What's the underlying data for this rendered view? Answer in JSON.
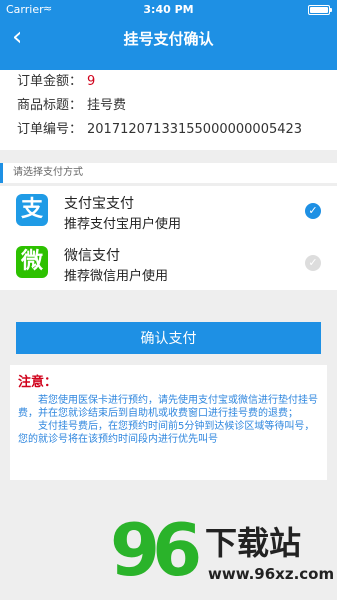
{
  "status": {
    "carrier": "Carrier",
    "wifi": "≈",
    "time": "3:40 PM"
  },
  "nav": {
    "back": "‹",
    "title": "挂号支付确认"
  },
  "order": {
    "amount_label": "订单金额：",
    "amount_value": "9",
    "product_label": "商品标题：",
    "product_value": "挂号费",
    "number_label": "订单编号：",
    "number_value": "20171207133155000000005423"
  },
  "section_title": "请选择支付方式",
  "payments": [
    {
      "icon": "支",
      "name": "支付宝支付",
      "desc": "推荐支付宝用户使用",
      "selected": true
    },
    {
      "icon": "微",
      "name": "微信支付",
      "desc": "推荐微信用户使用",
      "selected": false
    }
  ],
  "confirm_label": "确认支付",
  "notice": {
    "title": "注意：",
    "p1": "若您使用医保卡进行预约，请先使用支付宝或微信进行垫付挂号费，并在您就诊结束后到自助机或收费窗口进行挂号费的退费；",
    "p2": "支付挂号费后，在您预约时间前5分钟到达候诊区域等待叫号，您的就诊号将在该预约时间段内进行优先叫号"
  },
  "watermark": {
    "num": "96",
    "text": "下载站",
    "url": "www.96xz.com"
  },
  "colors": {
    "primary": "#1e90e4",
    "alert": "#d0021b",
    "wechat": "#2dc100"
  }
}
